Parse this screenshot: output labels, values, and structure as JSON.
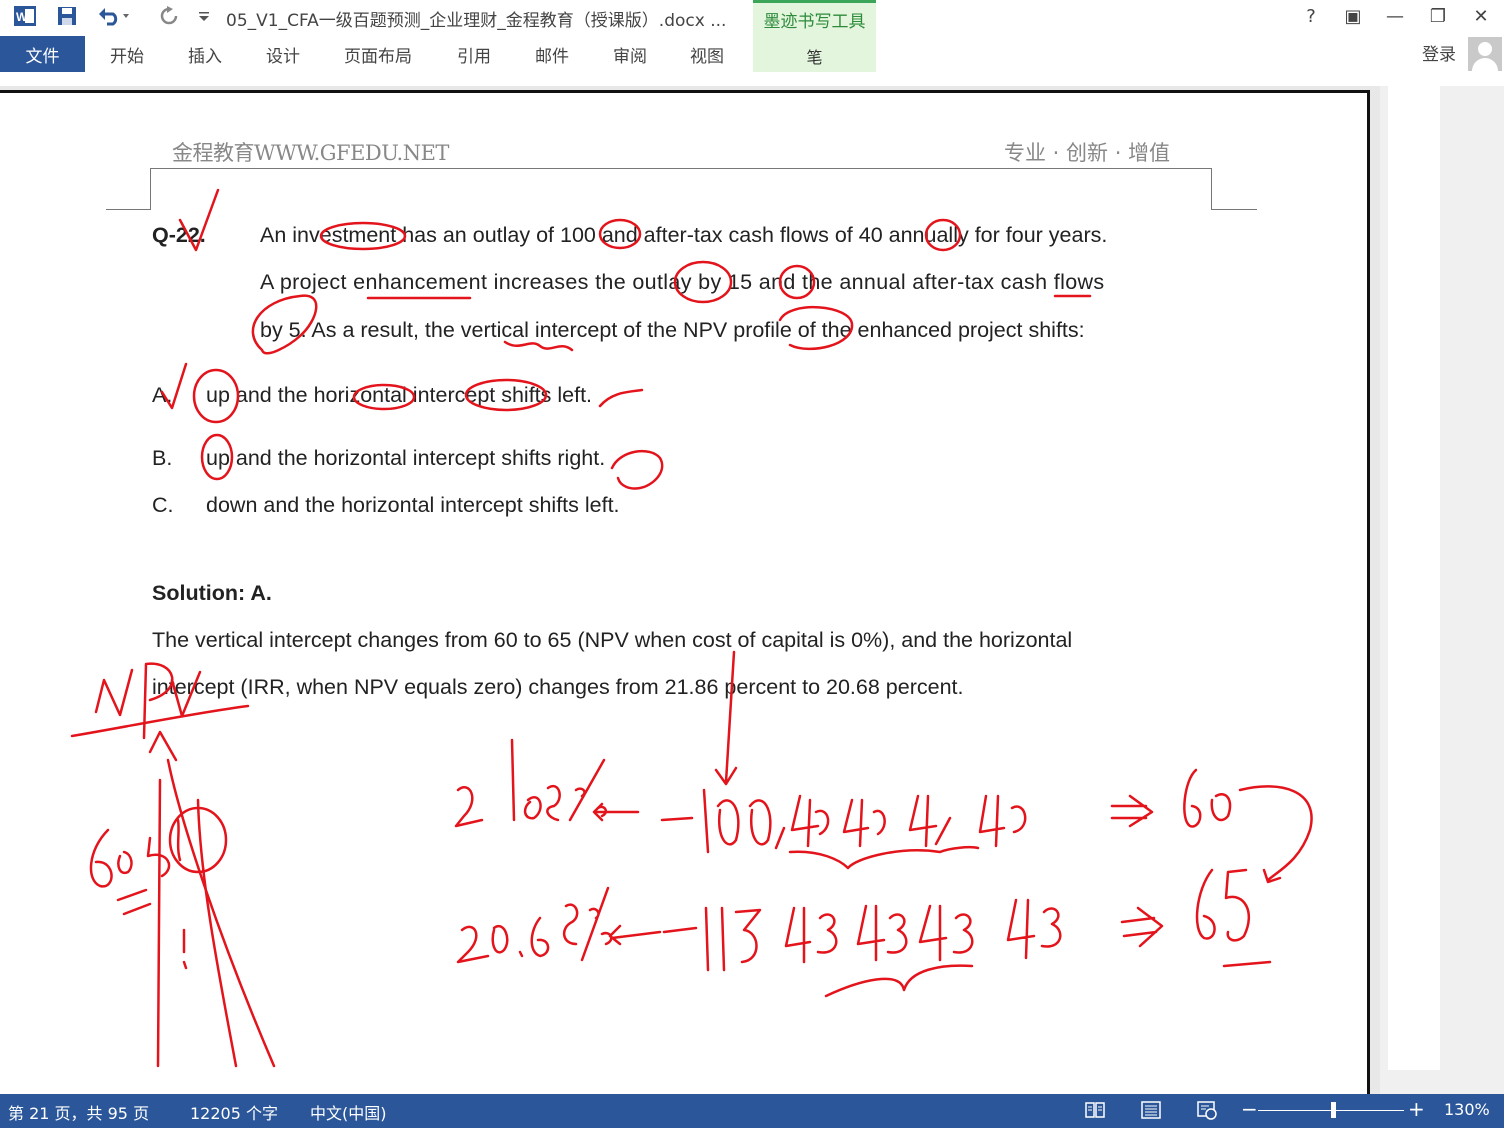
{
  "quick_access": {
    "word": "word-icon",
    "save": "save-icon",
    "undo": "undo-icon",
    "redo": "redo-icon",
    "customize": "customize-icon"
  },
  "title": "05_V1_CFA一级百题预测_企业理财_金程教育（授课版）.docx ...",
  "ink_tools": {
    "title": "墨迹书写工具",
    "pen": "笔"
  },
  "window": {
    "help": "?",
    "restore_ribbon": "▣",
    "minimize": "—",
    "restore": "❐",
    "close": "✕"
  },
  "ribbon": {
    "file": "文件",
    "tabs": [
      "开始",
      "插入",
      "设计",
      "页面布局",
      "引用",
      "邮件",
      "审阅",
      "视图"
    ],
    "login": "登录"
  },
  "document": {
    "header_left": "金程教育WWW.GFEDU.NET",
    "header_right": "专业 · 创新 · 增值",
    "question_id": "Q-22.",
    "question_lines": [
      "An investment has an outlay of 100 and after-tax cash flows of 40 annually for four years.",
      "A project enhancement increases the outlay by 15 and the annual after-tax cash flows",
      "by 5. As a result, the vertical intercept of the NPV profile of the enhanced project shifts:"
    ],
    "options": [
      {
        "letter": "A.",
        "text": "up and the horizontal intercept shifts left."
      },
      {
        "letter": "B.",
        "text": "up and the horizontal intercept shifts right."
      },
      {
        "letter": "C.",
        "text": "down and the horizontal intercept shifts left."
      }
    ],
    "solution_title": "Solution: A.",
    "solution_lines": [
      "The vertical intercept changes from 60 to 65 (NPV when cost of capital is 0%), and the horizontal",
      "intercept (IRR, when NPV equals zero) changes from 21.86 percent to 20.68 percent."
    ]
  },
  "handwriting": {
    "npv_label": "NPV",
    "axis_label": "60 65",
    "row1": "21.86% ⇐ -100, 40, 40, 40, 40  ⇒ 60",
    "row2": "20.68% ⇐ -115, 45, 45, 45, 45  ⇒ 65",
    "ink_color": "#e3141b"
  },
  "status": {
    "page": "第 21 页，共 95 页",
    "words": "12205 个字",
    "language": "中文(中国)",
    "zoom": "130%",
    "zoom_minus": "−",
    "zoom_plus": "+"
  }
}
